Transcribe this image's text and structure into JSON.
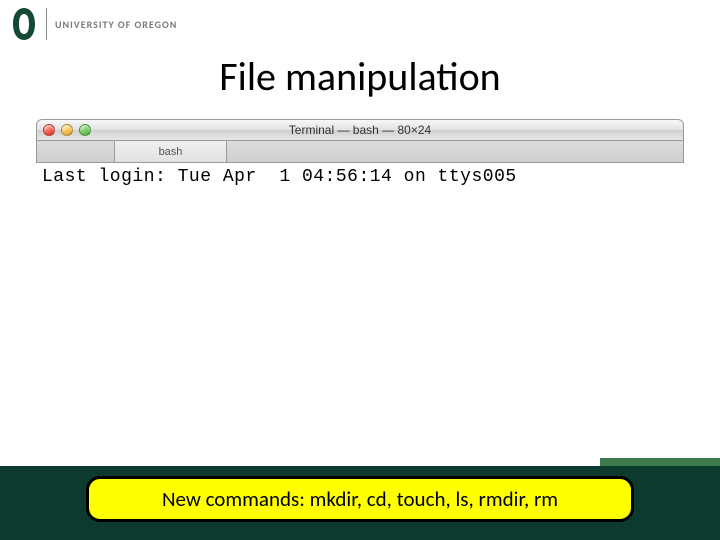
{
  "header": {
    "university": "UNIVERSITY OF OREGON"
  },
  "title": "File manipulation",
  "terminal": {
    "window_title": "Terminal — bash — 80×24",
    "tab_label": "bash",
    "line1": "Last login: Tue Apr  1 04:56:14 on ttys005"
  },
  "callout": "New commands: mkdir, cd, touch, ls, rmdir, rm"
}
